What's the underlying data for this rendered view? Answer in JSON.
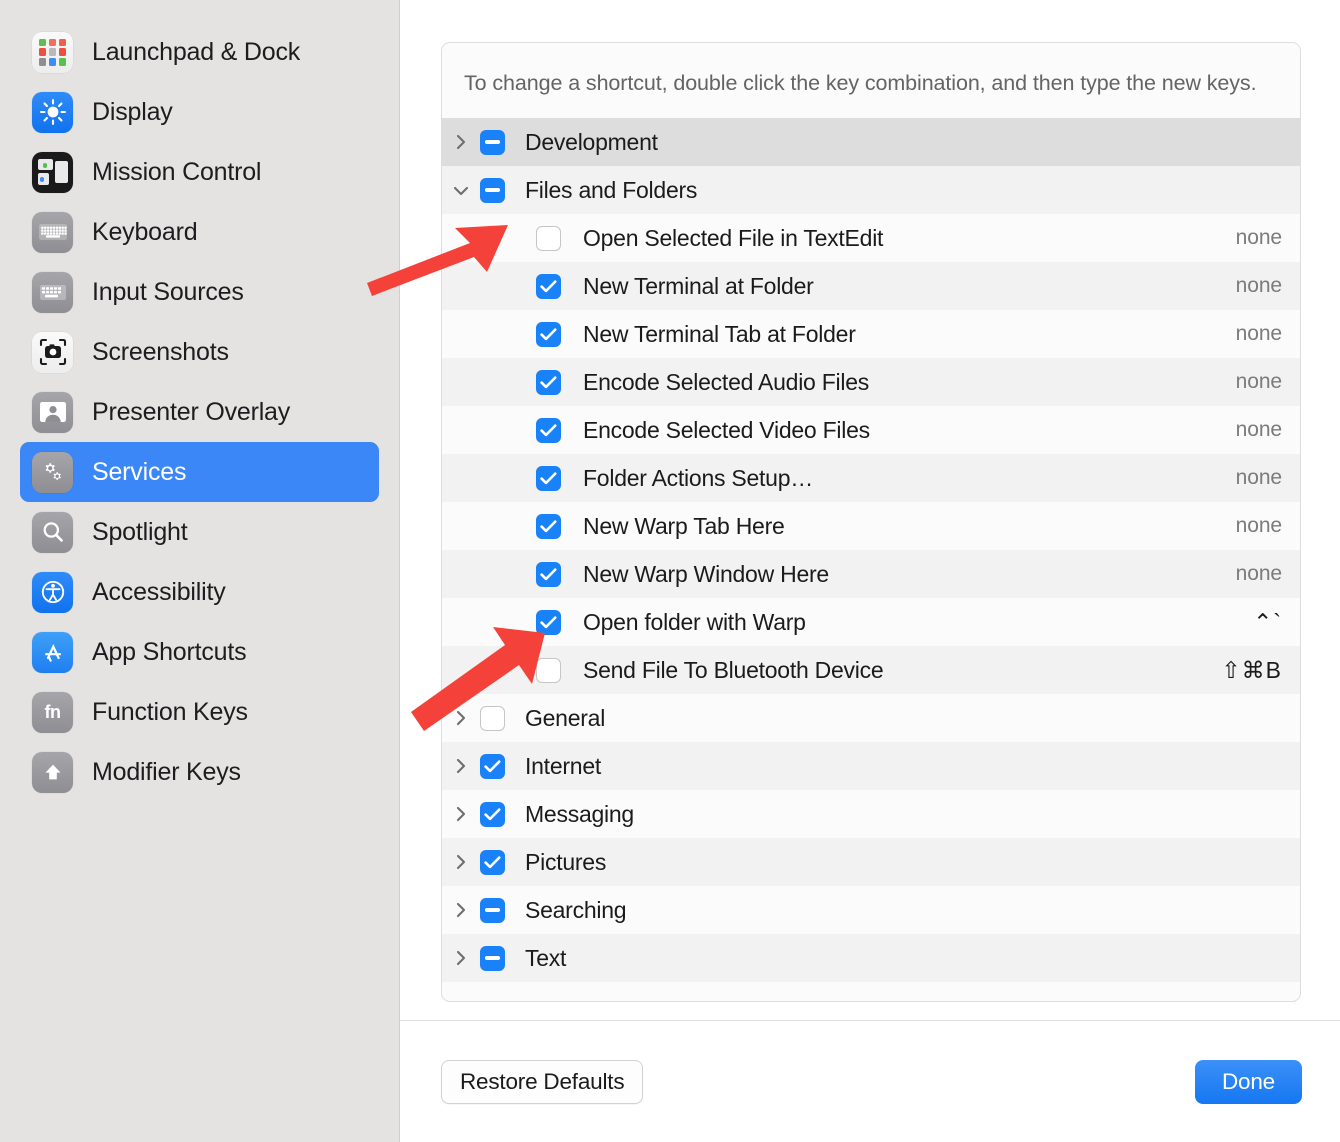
{
  "sidebar": {
    "items": [
      {
        "label": "Launchpad & Dock",
        "icon": "launchpad-icon",
        "selected": false
      },
      {
        "label": "Display",
        "icon": "display-icon",
        "selected": false
      },
      {
        "label": "Mission Control",
        "icon": "mission-control-icon",
        "selected": false
      },
      {
        "label": "Keyboard",
        "icon": "keyboard-icon",
        "selected": false
      },
      {
        "label": "Input Sources",
        "icon": "input-sources-icon",
        "selected": false
      },
      {
        "label": "Screenshots",
        "icon": "screenshots-icon",
        "selected": false
      },
      {
        "label": "Presenter Overlay",
        "icon": "presenter-overlay-icon",
        "selected": false
      },
      {
        "label": "Services",
        "icon": "services-icon",
        "selected": true
      },
      {
        "label": "Spotlight",
        "icon": "spotlight-icon",
        "selected": false
      },
      {
        "label": "Accessibility",
        "icon": "accessibility-icon",
        "selected": false
      },
      {
        "label": "App Shortcuts",
        "icon": "app-shortcuts-icon",
        "selected": false
      },
      {
        "label": "Function Keys",
        "icon": "function-keys-icon",
        "selected": false
      },
      {
        "label": "Modifier Keys",
        "icon": "modifier-keys-icon",
        "selected": false
      }
    ]
  },
  "panel": {
    "note": "To change a shortcut, double click the key combination, and then type the new keys.",
    "rows": [
      {
        "type": "group",
        "label": "Development",
        "checkbox": "mixed",
        "expanded": false,
        "shortcut": "",
        "active": true
      },
      {
        "type": "group",
        "label": "Files and Folders",
        "checkbox": "mixed",
        "expanded": true,
        "shortcut": "",
        "active": false
      },
      {
        "type": "child",
        "label": "Open Selected File in TextEdit",
        "checkbox": "off",
        "shortcut": "none"
      },
      {
        "type": "child",
        "label": "New Terminal at Folder",
        "checkbox": "on",
        "shortcut": "none"
      },
      {
        "type": "child",
        "label": "New Terminal Tab at Folder",
        "checkbox": "on",
        "shortcut": "none"
      },
      {
        "type": "child",
        "label": "Encode Selected Audio Files",
        "checkbox": "on",
        "shortcut": "none"
      },
      {
        "type": "child",
        "label": "Encode Selected Video Files",
        "checkbox": "on",
        "shortcut": "none"
      },
      {
        "type": "child",
        "label": "Folder Actions Setup…",
        "checkbox": "on",
        "shortcut": "none"
      },
      {
        "type": "child",
        "label": "New Warp Tab Here",
        "checkbox": "on",
        "shortcut": "none"
      },
      {
        "type": "child",
        "label": "New Warp Window Here",
        "checkbox": "on",
        "shortcut": "none"
      },
      {
        "type": "child",
        "label": "Open folder with Warp",
        "checkbox": "on",
        "shortcut": "⌃`",
        "shortcut_style": "keys",
        "highlighted": true
      },
      {
        "type": "child",
        "label": "Send File To Bluetooth Device",
        "checkbox": "off",
        "shortcut": "⇧⌘B",
        "shortcut_style": "keys"
      },
      {
        "type": "group",
        "label": "General",
        "checkbox": "off",
        "expanded": false,
        "shortcut": ""
      },
      {
        "type": "group",
        "label": "Internet",
        "checkbox": "on",
        "expanded": false,
        "shortcut": ""
      },
      {
        "type": "group",
        "label": "Messaging",
        "checkbox": "on",
        "expanded": false,
        "shortcut": ""
      },
      {
        "type": "group",
        "label": "Pictures",
        "checkbox": "on",
        "expanded": false,
        "shortcut": ""
      },
      {
        "type": "group",
        "label": "Searching",
        "checkbox": "mixed",
        "expanded": false,
        "shortcut": ""
      },
      {
        "type": "group",
        "label": "Text",
        "checkbox": "mixed",
        "expanded": false,
        "shortcut": ""
      }
    ]
  },
  "footer": {
    "restore_defaults_label": "Restore Defaults",
    "done_label": "Done"
  },
  "annotations": {
    "highlight_color": "#f4423a",
    "arrows": [
      {
        "name": "arrow-to-files-and-folders-checkbox"
      },
      {
        "name": "arrow-to-open-folder-with-warp-checkbox"
      }
    ]
  },
  "colors": {
    "accent": "#1a82f8",
    "selection": "#3b87f7",
    "sidebar_bg": "#e4e3e2",
    "panel_bg": "#fbfbfb",
    "row_alt_bg": "#f2f2f2",
    "row_active_bg": "#dddddd",
    "annotation_red": "#f4423a"
  }
}
